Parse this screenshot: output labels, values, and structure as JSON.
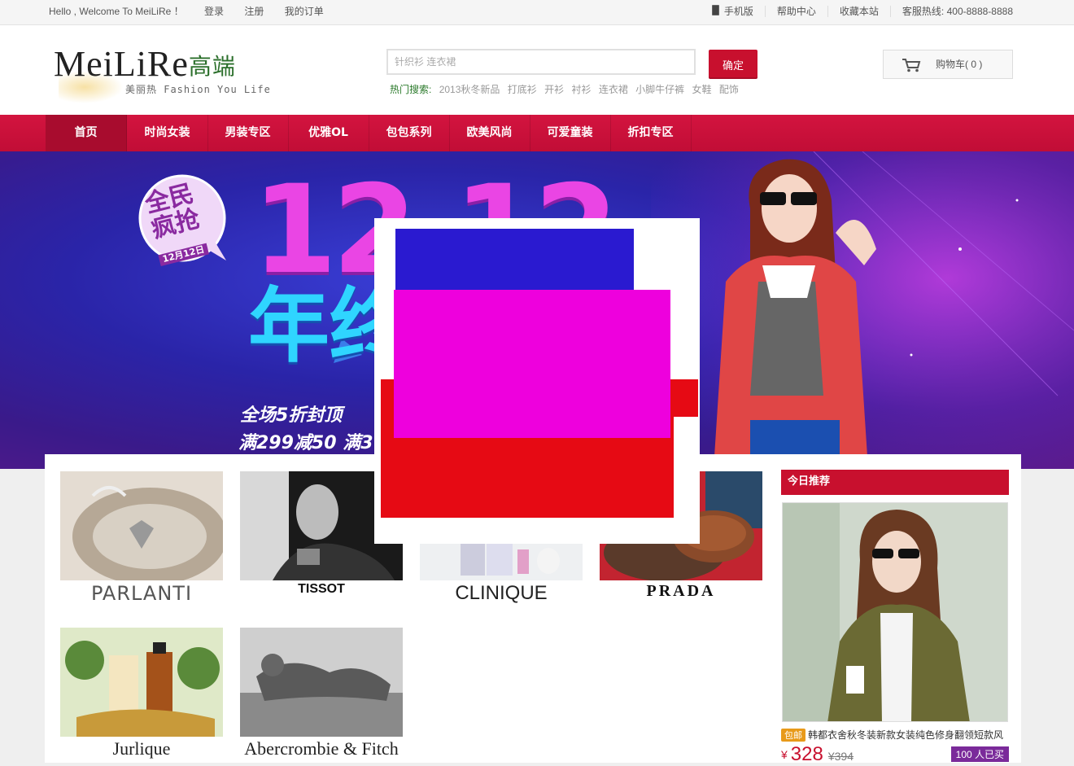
{
  "topbar": {
    "welcome": "Hello , Welcome To MeiLiRe ！",
    "login": "登录",
    "register": "注册",
    "my_orders": "我的订单",
    "mobile": "手机版",
    "help": "帮助中心",
    "favorite": "收藏本站",
    "hotline": "客服热线: 400-8888-8888"
  },
  "header": {
    "logo_text": "MeiLiRe",
    "logo_cn": "高端",
    "logo_tagline": "美丽热 Fashion You Life",
    "search_placeholder": "针织衫 连衣裙",
    "search_button": "确定",
    "hot_label": "热门搜索:",
    "hot_keywords": [
      "2013秋冬新品",
      "打底衫",
      "开衫",
      "衬衫",
      "连衣裙",
      "小脚牛仔裤",
      "女鞋",
      "配饰"
    ],
    "cart_label": "购物车( 0 )"
  },
  "nav": {
    "items": [
      "首页",
      "时尚女装",
      "男装专区",
      "优雅OL",
      "包包系列",
      "欧美风尚",
      "可爱童装",
      "折扣专区"
    ]
  },
  "banner": {
    "badge_line1": "全民",
    "badge_line2": "疯抢",
    "badge_date": "12月12日",
    "big_number": "12.12",
    "headline": "年终",
    "promo1": "全场5折封顶",
    "promo2": "满299减50 满3"
  },
  "brands": [
    "PARLANTI",
    "TISSOT",
    "CLINIQUE",
    "PRADA",
    "Jurlique",
    "Abercrombie & Fitch"
  ],
  "today": {
    "title": "今日推荐",
    "tag": "包邮",
    "product_name": "韩都衣舍秋冬装新款女装纯色修身翻领短款风",
    "currency": "¥",
    "price": "328",
    "old_price": "¥394",
    "sold": "100 人已买"
  },
  "colors": {
    "accent": "#c8102e",
    "nav_active": "#a80c2e"
  }
}
